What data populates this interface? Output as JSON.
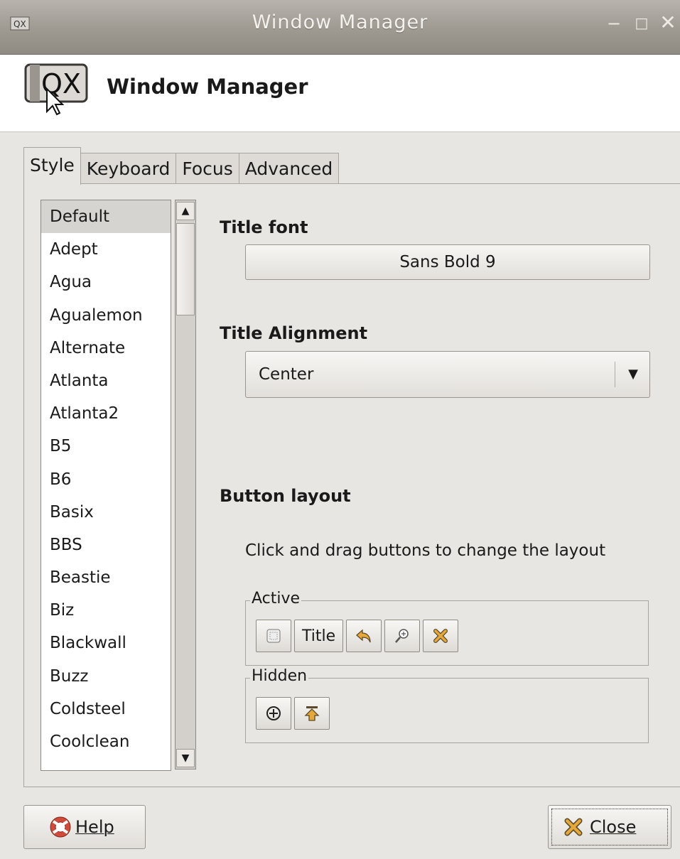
{
  "window": {
    "title": "Window Manager",
    "icon": "window-manager-icon",
    "controls": [
      "minimize-icon",
      "maximize-icon",
      "close-icon"
    ]
  },
  "header": {
    "title": "Window Manager",
    "icon": "window-manager-icon"
  },
  "tabs": [
    {
      "label": "Style",
      "active": true
    },
    {
      "label": "Keyboard",
      "active": false
    },
    {
      "label": "Focus",
      "active": false
    },
    {
      "label": "Advanced",
      "active": false
    }
  ],
  "themes": {
    "selected": "Default",
    "items": [
      "Default",
      "Adept",
      "Agua",
      "Agualemon",
      "Alternate",
      "Atlanta",
      "Atlanta2",
      "B5",
      "B6",
      "Basix",
      "BBS",
      "Beastie",
      "Biz",
      "Blackwall",
      "Buzz",
      "Coldsteel",
      "Coolclean"
    ]
  },
  "title_font": {
    "label": "Title font",
    "value": "Sans Bold 9"
  },
  "title_alignment": {
    "label": "Title Alignment",
    "value": "Center"
  },
  "button_layout": {
    "label": "Button layout",
    "hint": "Click and drag buttons to change the layout",
    "active_label": "Active",
    "hidden_label": "Hidden",
    "active_buttons": [
      "menu-icon",
      "Title",
      "shade-icon",
      "maximize-icon",
      "close-icon"
    ],
    "hidden_buttons": [
      "stick-icon",
      "minimize-icon"
    ]
  },
  "footer": {
    "help_label": "Help",
    "close_label": "Close"
  },
  "colors": {
    "titlebar": "#a09b93",
    "selection": "#d6d4d0",
    "accent": "#e08a1c"
  }
}
